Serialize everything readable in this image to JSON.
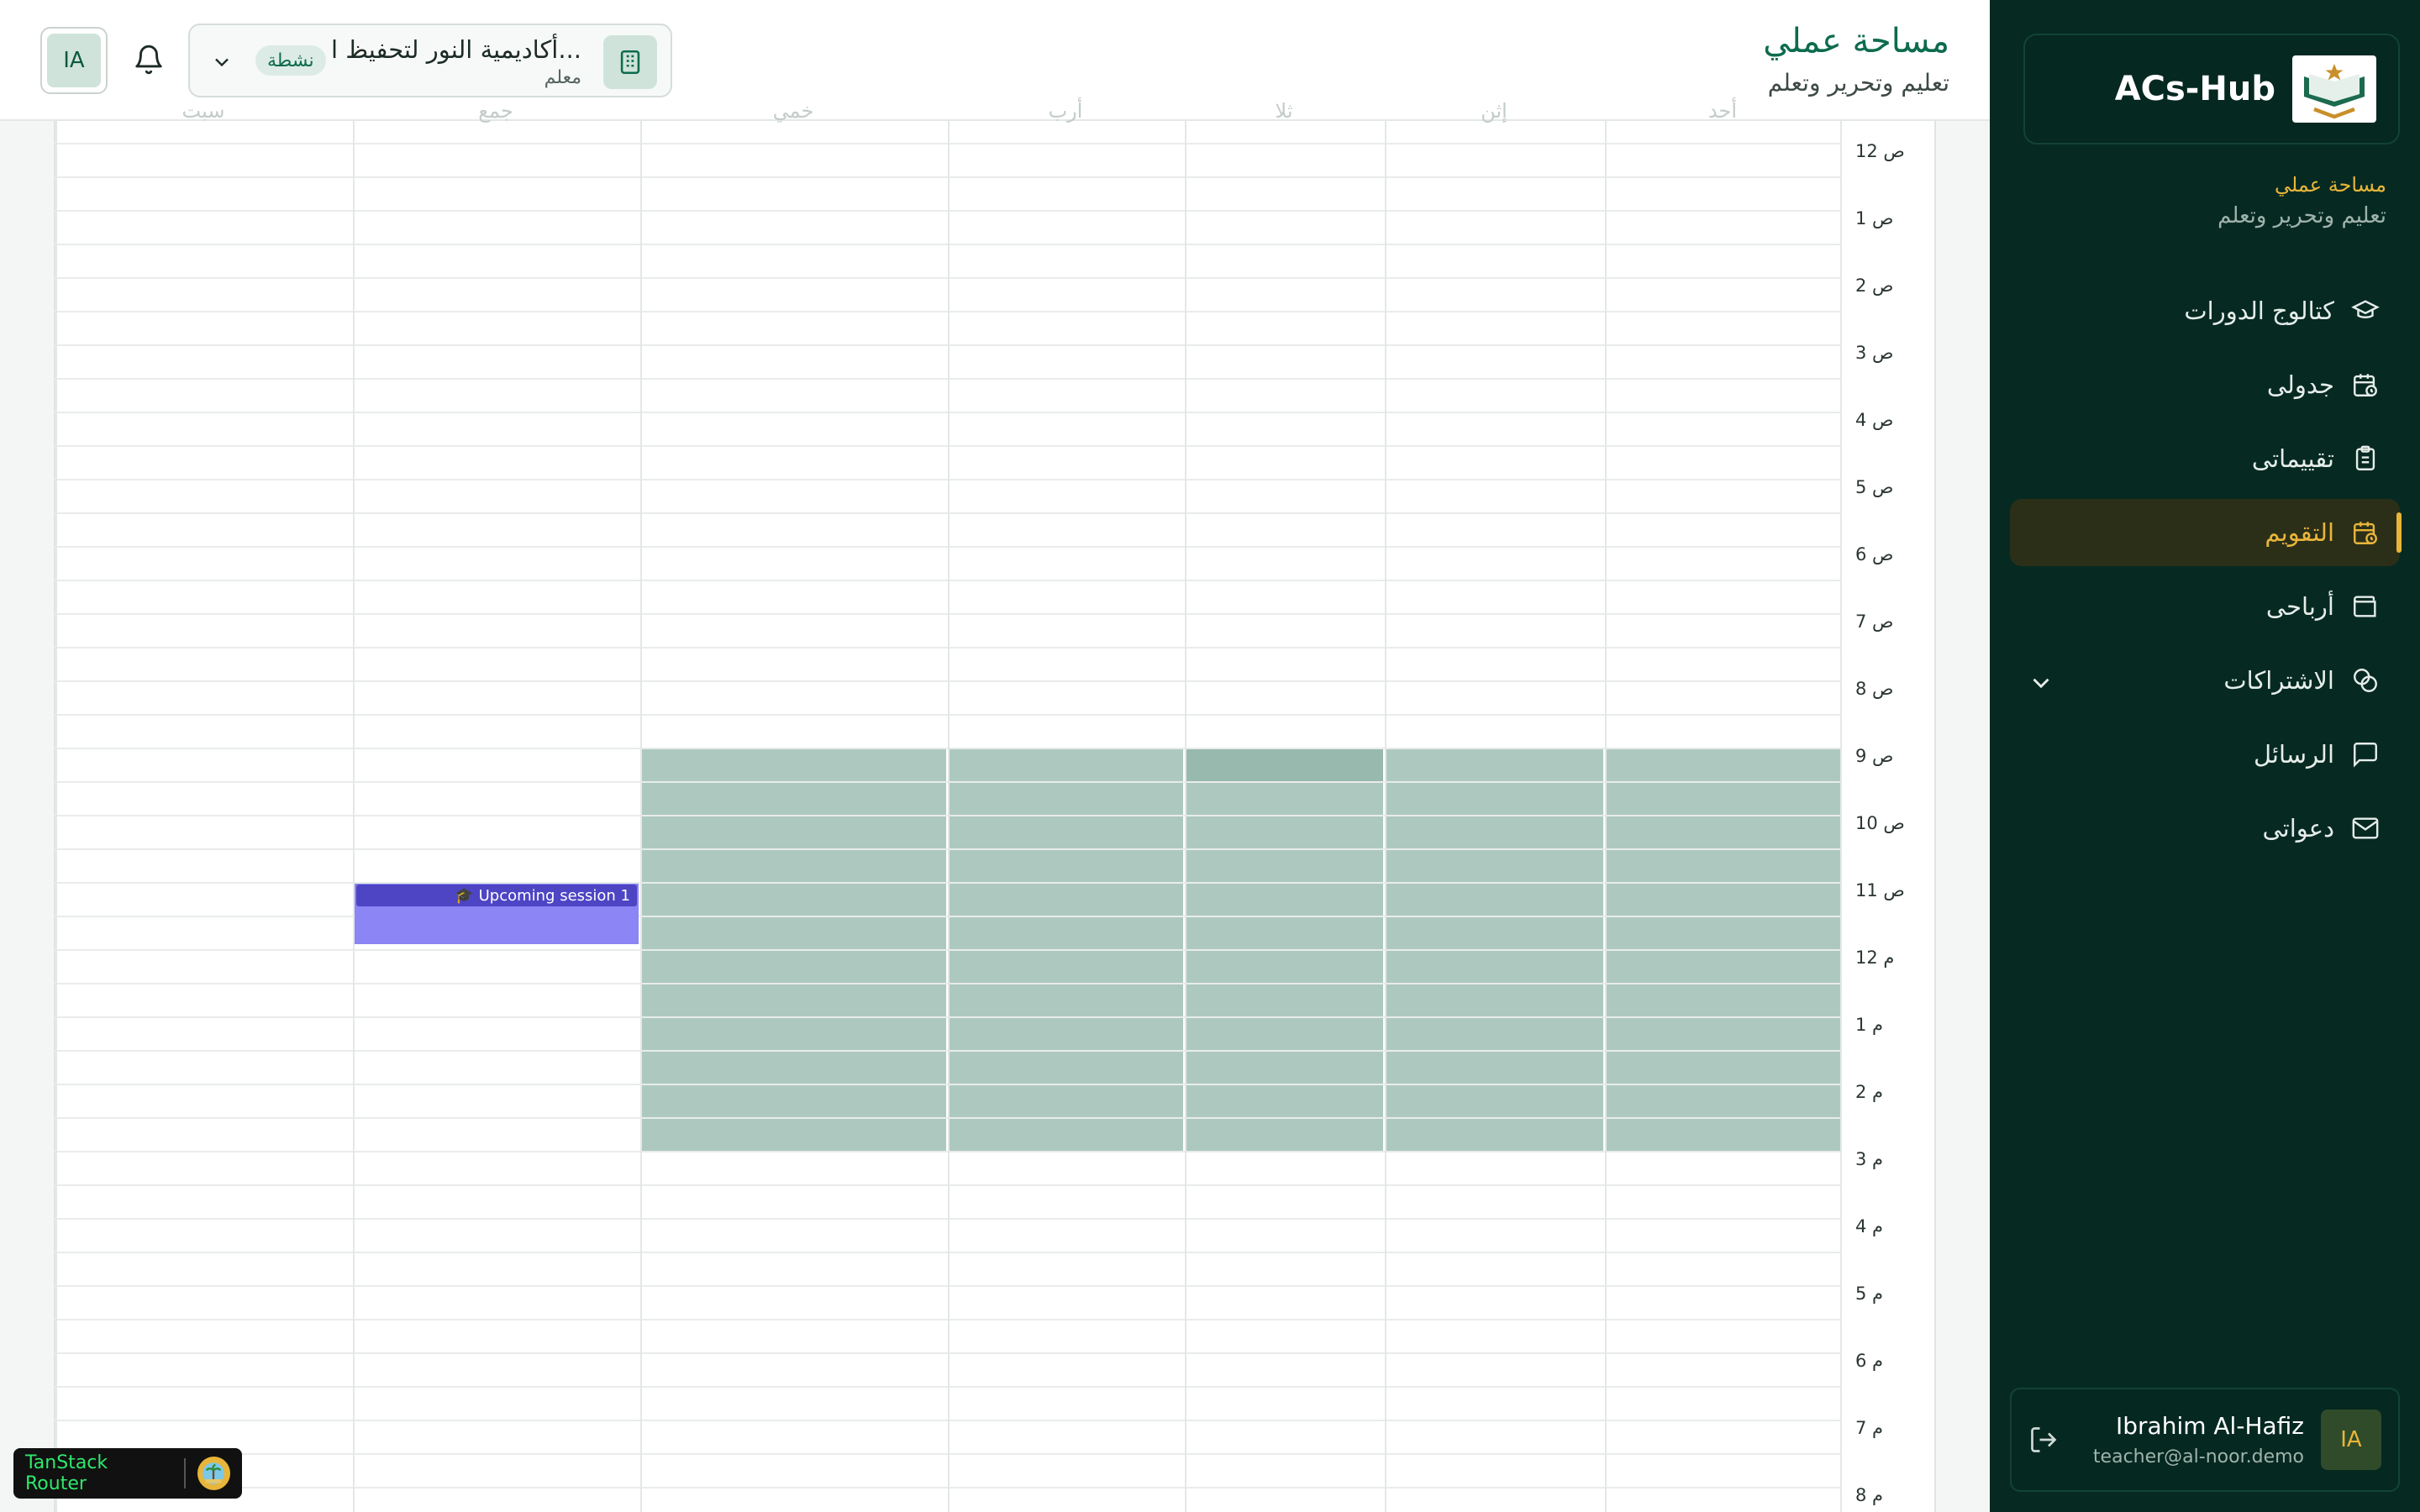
{
  "sidebar": {
    "brand": "ACs-Hub",
    "workspace_title": "مساحة عملي",
    "workspace_subtitle": "تعليم وتحرير وتعلم",
    "items": [
      {
        "label": "كتالوج الدورات",
        "icon": "graduation-cap-icon"
      },
      {
        "label": "جدولى",
        "icon": "calendar-clock-icon"
      },
      {
        "label": "تقييماتى",
        "icon": "clipboard-icon"
      },
      {
        "label": "التقويم",
        "icon": "calendar-clock-icon",
        "active": true
      },
      {
        "label": "أرباحى",
        "icon": "wallet-icon"
      },
      {
        "label": "الاشتراكات",
        "icon": "subscriptions-icon",
        "has_chevron": true
      },
      {
        "label": "الرسائل",
        "icon": "message-icon"
      },
      {
        "label": "دعواتى",
        "icon": "mail-icon"
      }
    ],
    "user": {
      "initials": "IA",
      "name": "Ibrahim Al-Hafiz",
      "email": "teacher@al-noor.demo"
    }
  },
  "header": {
    "title": "مساحة عملي",
    "subtitle": "تعليم وتحرير وتعلم",
    "org": {
      "name": "أكاديمية النور لتحفيظ ا...",
      "role": "معلم",
      "status": "نشطة"
    },
    "avatar_initials": "IA"
  },
  "calendar": {
    "days": [
      "أحد",
      "إثن",
      "ثلا",
      "أرب",
      "خمي",
      "جمع",
      "سبت"
    ],
    "times": [
      "12 ص",
      "1 ص",
      "2 ص",
      "3 ص",
      "4 ص",
      "5 ص",
      "6 ص",
      "7 ص",
      "8 ص",
      "9 ص",
      "10 ص",
      "11 ص",
      "12 م",
      "1 م",
      "2 م",
      "3 م",
      "4 م",
      "5 م",
      "6 م",
      "7 م",
      "8 م"
    ],
    "availability": {
      "days": [
        "أحد",
        "إثن",
        "ثلا",
        "أرب",
        "خمي"
      ],
      "from": "9 ص",
      "to": "3 م"
    },
    "event": {
      "title": "Upcoming session 1",
      "icon": "graduation-cap-icon",
      "day": "جمع",
      "start": "11 ص",
      "end": "12 م"
    }
  },
  "devtools": {
    "label": "TanStack Router"
  },
  "colors": {
    "sidebar_bg": "#062a22",
    "accent": "#e8b53a",
    "primary": "#0d6b4e",
    "availability": "#adc9bf",
    "event": "#8b85f5",
    "event_label": "#4d45c4"
  }
}
